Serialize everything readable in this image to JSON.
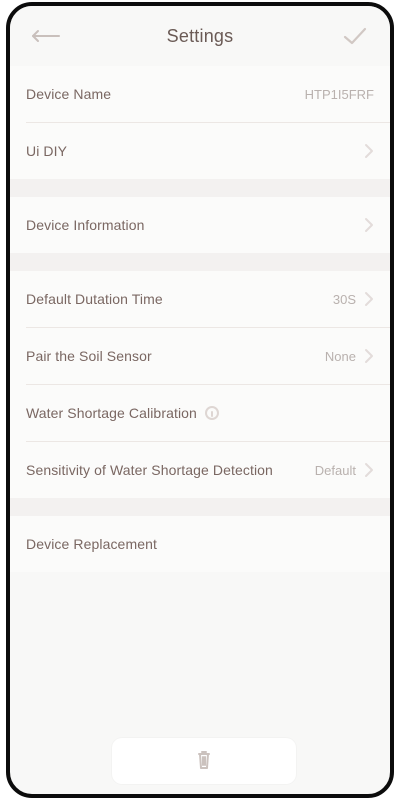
{
  "header": {
    "title": "Settings"
  },
  "icons": {
    "back": "back-arrow-icon",
    "confirm": "check-icon",
    "chevron": "chevron-right-icon",
    "info": "info-icon",
    "delete": "trash-icon"
  },
  "rows": {
    "device_name": {
      "label": "Device Name",
      "value": "HTP1I5FRF"
    },
    "ui_diy": {
      "label": "Ui DIY"
    },
    "device_information": {
      "label": "Device Information"
    },
    "default_duration": {
      "label": "Default Dutation Time",
      "value": "30S"
    },
    "pair_soil_sensor": {
      "label": "Pair the Soil Sensor",
      "value": "None"
    },
    "water_shortage_calibration": {
      "label": "Water Shortage Calibration"
    },
    "sensitivity_water_shortage": {
      "label": "Sensitivity of Water Shortage Detection",
      "value": "Default"
    },
    "device_replacement": {
      "label": "Device Replacement"
    }
  },
  "colors": {
    "text": "#6a5a55",
    "muted": "#b9b1ae",
    "divider": "#ece7e4",
    "frame": "#0c0c0c"
  }
}
